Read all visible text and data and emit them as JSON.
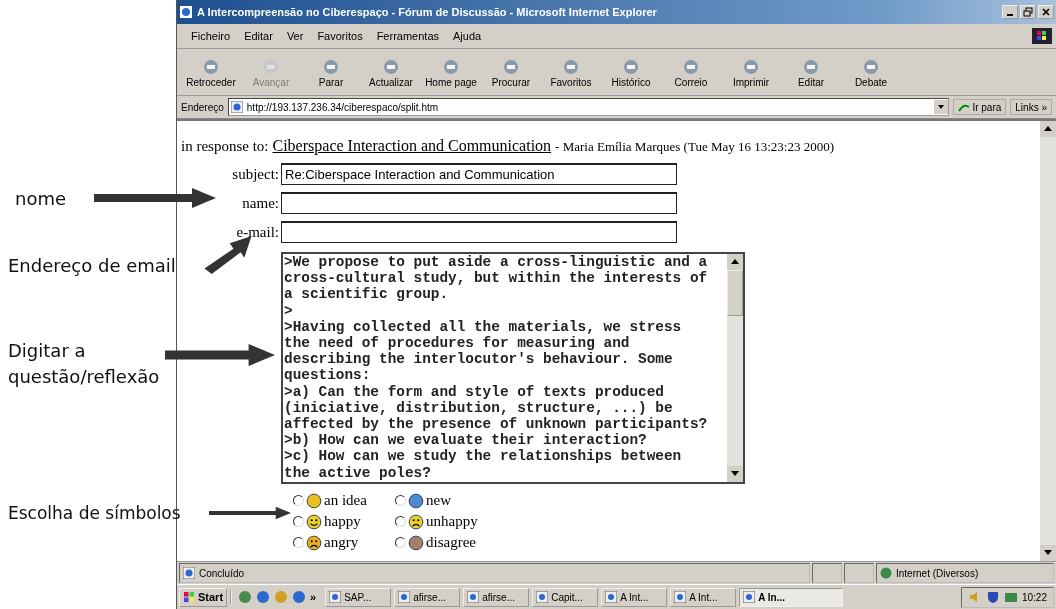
{
  "annotations": [
    {
      "label": "nome"
    },
    {
      "label": "Endereço de email"
    },
    {
      "label": "Digitar a questão/reflexão"
    },
    {
      "label": "Escolha de símbolos"
    }
  ],
  "window": {
    "title": "A Intercompreensão no Ciberespaço - Fórum de Discussão - Microsoft Internet Explorer"
  },
  "menu": [
    "Ficheiro",
    "Editar",
    "Ver",
    "Favoritos",
    "Ferramentas",
    "Ajuda"
  ],
  "toolbar": [
    {
      "label": "Retroceder",
      "disabled": false
    },
    {
      "label": "Avançar",
      "disabled": true
    },
    {
      "label": "Parar",
      "disabled": false
    },
    {
      "label": "Actualizar",
      "disabled": false
    },
    {
      "label": "Home page",
      "disabled": false
    },
    {
      "label": "Procurar",
      "disabled": false
    },
    {
      "label": "Favoritos",
      "disabled": false
    },
    {
      "label": "Histórico",
      "disabled": false
    },
    {
      "label": "Correio",
      "disabled": false
    },
    {
      "label": "Imprimir",
      "disabled": false
    },
    {
      "label": "Editar",
      "disabled": false
    },
    {
      "label": "Debate",
      "disabled": false
    }
  ],
  "address": {
    "label": "Endereço",
    "value": "http://193.137.236.34/ciberespaco/split.htm",
    "go": "Ir para",
    "links": "Links »"
  },
  "page": {
    "response_label": "in response to:",
    "response_link": "Ciberspace Interaction and Communication",
    "response_meta": "- Maria Emília Marques (Tue May 16 13:23:23 2000)",
    "fields": [
      {
        "label": "subject:",
        "value": "Re:Ciberspace Interaction and Communication"
      },
      {
        "label": "name:"
      },
      {
        "label": "e-mail:"
      }
    ],
    "message": ">We propose to put aside a cross-linguistic and a\ncross-cultural study, but within the interests of\na scientific group.\n>\n>Having collected all the materials, we stress\nthe need of procedures for measuring and\ndescribing the interlocutor's behaviour. Some\nquestions:\n>a) Can the form and style of texts produced\n(iniciative, distribution, structure, ...) be\naffected by the presence of unknown participants?\n>b) How can we evaluate their interaction?\n>c) How can we study the relationships between\nthe active poles?",
    "symbols": [
      {
        "label": "an idea",
        "selected": false
      },
      {
        "label": "new",
        "selected": false
      },
      {
        "label": "happy",
        "selected": false
      },
      {
        "label": "unhappy",
        "selected": false
      },
      {
        "label": "angry",
        "selected": false
      },
      {
        "label": "disagree",
        "selected": false
      }
    ]
  },
  "status_bar": {
    "text": "Concluído",
    "zone": "Internet (Diversos)"
  },
  "taskbar": {
    "start": "Start",
    "more": "»",
    "tasks": [
      {
        "label": "SAP...",
        "selected": false
      },
      {
        "label": "afirse...",
        "selected": false
      },
      {
        "label": "afirse...",
        "selected": false
      },
      {
        "label": "Capit...",
        "selected": false
      },
      {
        "label": "A Int...",
        "selected": false
      },
      {
        "label": "A Int...",
        "selected": false
      },
      {
        "label": "A In...",
        "selected": true
      }
    ],
    "time": "10:22"
  }
}
